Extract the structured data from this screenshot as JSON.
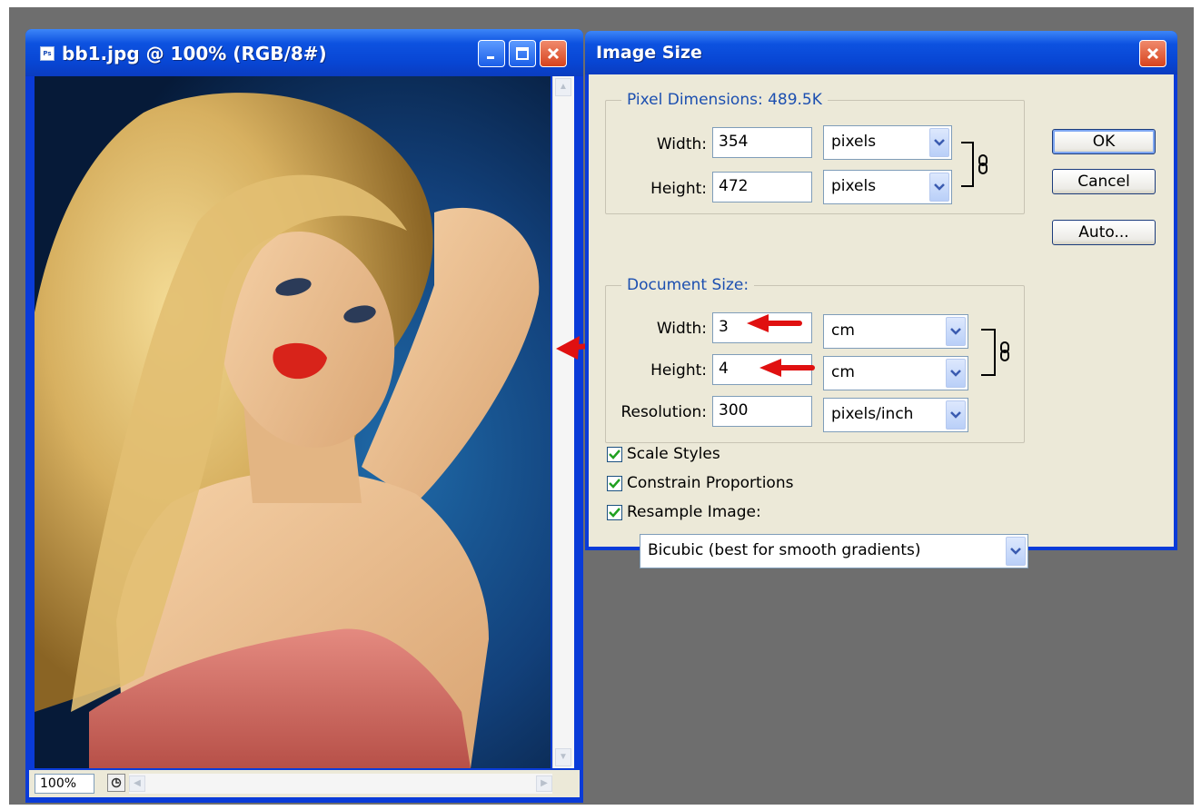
{
  "document_window": {
    "title": "bb1.jpg @ 100% (RGB/8#)",
    "app_icon": "ps-icon",
    "zoom": "100%"
  },
  "dialog": {
    "title": "Image Size",
    "pixel_dimensions": {
      "legend": "Pixel Dimensions:  489.5K",
      "width_label": "Width:",
      "width_value": "354",
      "width_unit": "pixels",
      "height_label": "Height:",
      "height_value": "472",
      "height_unit": "pixels"
    },
    "document_size": {
      "legend": "Document Size:",
      "width_label": "Width:",
      "width_value": "3",
      "width_unit": "cm",
      "height_label": "Height:",
      "height_value": "4",
      "height_unit": "cm",
      "resolution_label": "Resolution:",
      "resolution_value": "300",
      "resolution_unit": "pixels/inch"
    },
    "buttons": {
      "ok": "OK",
      "cancel": "Cancel",
      "auto": "Auto..."
    },
    "checkboxes": {
      "scale_styles": "Scale Styles",
      "constrain_proportions": "Constrain Proportions",
      "resample_image": "Resample Image:"
    },
    "resample_method": "Bicubic (best for smooth gradients)"
  },
  "colors": {
    "title_bar": "#0846d4",
    "dialog_bg": "#ece9d8",
    "annotation_arrow": "#e01010"
  }
}
